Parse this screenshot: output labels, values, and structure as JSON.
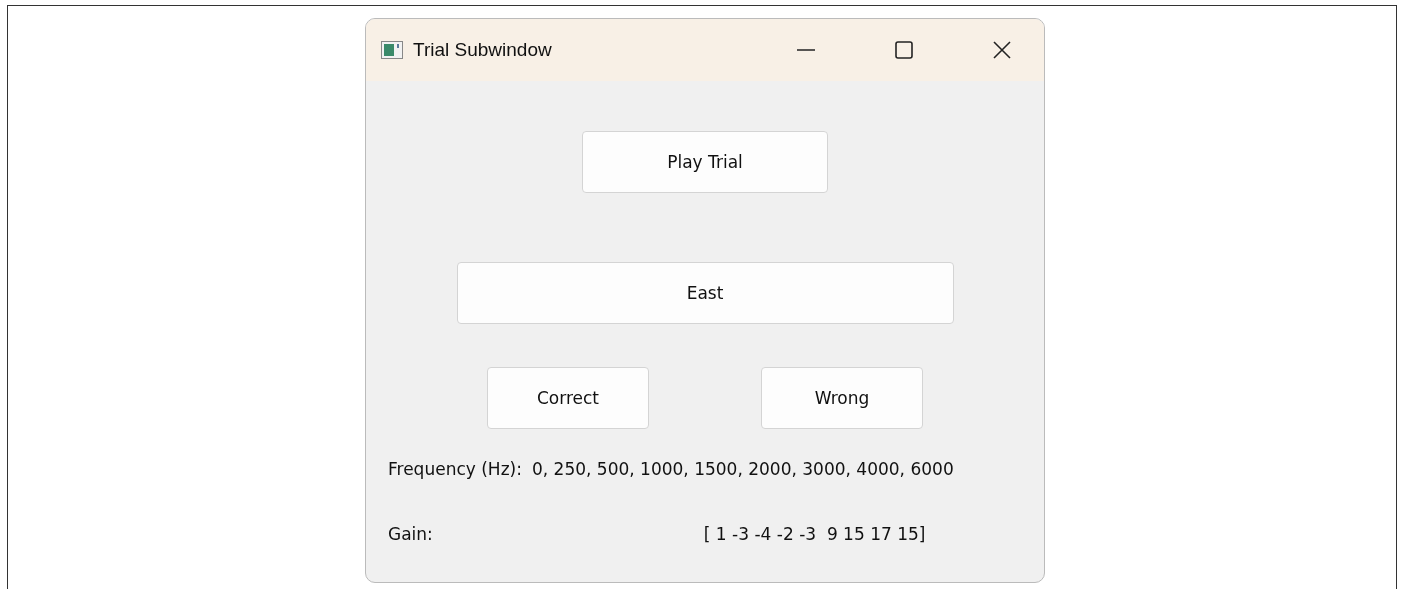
{
  "window": {
    "title": "Trial Subwindow"
  },
  "play_button": {
    "label": "Play Trial"
  },
  "direction_button": {
    "label": "East"
  },
  "answer_buttons": [
    {
      "label": "Correct"
    },
    {
      "label": "Wrong"
    }
  ],
  "frequency": {
    "label": "Frequency (Hz):",
    "value": "0, 250, 500, 1000, 1500, 2000, 3000, 4000, 6000"
  },
  "gain": {
    "label": "Gain:",
    "value": "[ 1 -3 -4 -2 -3  9 15 17 15]"
  }
}
